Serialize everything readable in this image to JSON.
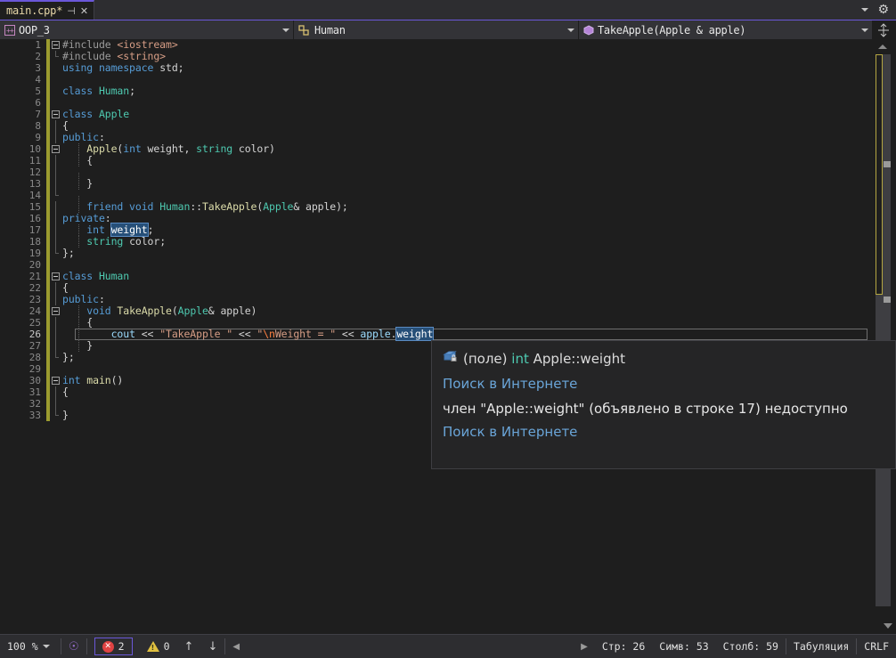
{
  "tab": {
    "title": "main.cpp*",
    "pin_icon": "pin-icon",
    "close_icon": "close-icon",
    "overflow_icon": "chevron-down-icon",
    "settings_icon": "gear-icon"
  },
  "navbar": {
    "project": "OOP_3",
    "project_icon": "cpp-project-icon",
    "class": "Human",
    "class_icon": "class-icon",
    "member": "TakeApple(Apple & apple)",
    "member_icon": "method-icon",
    "split_icon": "split-window-icon"
  },
  "editor": {
    "lines": [
      {
        "n": 1,
        "fold": "minus",
        "indent": 0,
        "mod": true,
        "tokens": [
          {
            "t": "#include ",
            "c": "pp"
          },
          {
            "t": "<iostream>",
            "c": "st"
          }
        ]
      },
      {
        "n": 2,
        "fold": "end",
        "indent": 0,
        "mod": true,
        "tokens": [
          {
            "t": "#include ",
            "c": "pp"
          },
          {
            "t": "<string>",
            "c": "st"
          }
        ]
      },
      {
        "n": 3,
        "fold": "none",
        "indent": 0,
        "mod": true,
        "tokens": [
          {
            "t": "using namespace ",
            "c": "k"
          },
          {
            "t": "std;",
            "c": "pl"
          }
        ]
      },
      {
        "n": 4,
        "fold": "none",
        "indent": 0,
        "mod": true,
        "tokens": []
      },
      {
        "n": 5,
        "fold": "none",
        "indent": 0,
        "mod": true,
        "tokens": [
          {
            "t": "class ",
            "c": "k"
          },
          {
            "t": "Human",
            "c": "ty"
          },
          {
            "t": ";",
            "c": "pl"
          }
        ]
      },
      {
        "n": 6,
        "fold": "none",
        "indent": 0,
        "mod": true,
        "tokens": []
      },
      {
        "n": 7,
        "fold": "minus",
        "indent": 0,
        "mod": true,
        "tokens": [
          {
            "t": "class ",
            "c": "k"
          },
          {
            "t": "Apple",
            "c": "ty"
          }
        ]
      },
      {
        "n": 8,
        "fold": "vline",
        "indent": 0,
        "mod": true,
        "tokens": [
          {
            "t": "{",
            "c": "pl"
          }
        ]
      },
      {
        "n": 9,
        "fold": "vline",
        "indent": 0,
        "mod": true,
        "tokens": [
          {
            "t": "public",
            "c": "k"
          },
          {
            "t": ":",
            "c": "pl"
          }
        ]
      },
      {
        "n": 10,
        "fold": "minus2",
        "indent": 1,
        "mod": true,
        "tokens": [
          {
            "t": "    ",
            "c": "pl"
          },
          {
            "t": "Apple",
            "c": "fn"
          },
          {
            "t": "(",
            "c": "pl"
          },
          {
            "t": "int",
            "c": "k"
          },
          {
            "t": " weight, ",
            "c": "pl"
          },
          {
            "t": "string",
            "c": "ty"
          },
          {
            "t": " color)",
            "c": "pl"
          }
        ]
      },
      {
        "n": 11,
        "fold": "vline",
        "indent": 1,
        "mod": true,
        "tokens": [
          {
            "t": "    {",
            "c": "pl"
          }
        ]
      },
      {
        "n": 12,
        "fold": "vline",
        "indent": 1,
        "mod": true,
        "tokens": []
      },
      {
        "n": 13,
        "fold": "vline",
        "indent": 1,
        "mod": true,
        "tokens": [
          {
            "t": "    }",
            "c": "pl"
          }
        ]
      },
      {
        "n": 14,
        "fold": "vend",
        "indent": 1,
        "mod": true,
        "tokens": []
      },
      {
        "n": 15,
        "fold": "vline",
        "indent": 1,
        "mod": true,
        "tokens": [
          {
            "t": "    ",
            "c": "pl"
          },
          {
            "t": "friend void ",
            "c": "k"
          },
          {
            "t": "Human",
            "c": "ty"
          },
          {
            "t": "::",
            "c": "pl"
          },
          {
            "t": "TakeApple",
            "c": "fn"
          },
          {
            "t": "(",
            "c": "pl"
          },
          {
            "t": "Apple",
            "c": "ty"
          },
          {
            "t": "& apple);",
            "c": "pl"
          }
        ]
      },
      {
        "n": 16,
        "fold": "vline",
        "indent": 0,
        "mod": true,
        "tokens": [
          {
            "t": "private",
            "c": "k"
          },
          {
            "t": ":",
            "c": "pl"
          }
        ]
      },
      {
        "n": 17,
        "fold": "vline",
        "indent": 1,
        "mod": true,
        "tokens": [
          {
            "t": "    ",
            "c": "pl"
          },
          {
            "t": "int",
            "c": "k"
          },
          {
            "t": " ",
            "c": "pl"
          },
          {
            "t": "weight",
            "c": "sel"
          },
          {
            "t": ";",
            "c": "pl"
          }
        ]
      },
      {
        "n": 18,
        "fold": "vline",
        "indent": 1,
        "mod": true,
        "tokens": [
          {
            "t": "    ",
            "c": "pl"
          },
          {
            "t": "string",
            "c": "ty"
          },
          {
            "t": " color;",
            "c": "pl"
          }
        ]
      },
      {
        "n": 19,
        "fold": "end",
        "indent": 0,
        "mod": true,
        "tokens": [
          {
            "t": "};",
            "c": "pl"
          }
        ]
      },
      {
        "n": 20,
        "fold": "none",
        "indent": 0,
        "mod": true,
        "tokens": []
      },
      {
        "n": 21,
        "fold": "minus",
        "indent": 0,
        "mod": true,
        "tokens": [
          {
            "t": "class ",
            "c": "k"
          },
          {
            "t": "Human",
            "c": "ty"
          }
        ]
      },
      {
        "n": 22,
        "fold": "vline",
        "indent": 0,
        "mod": true,
        "tokens": [
          {
            "t": "{",
            "c": "pl"
          }
        ]
      },
      {
        "n": 23,
        "fold": "vline",
        "indent": 0,
        "mod": true,
        "tokens": [
          {
            "t": "public",
            "c": "k"
          },
          {
            "t": ":",
            "c": "pl"
          }
        ]
      },
      {
        "n": 24,
        "fold": "minus2",
        "indent": 1,
        "mod": true,
        "tokens": [
          {
            "t": "    ",
            "c": "pl"
          },
          {
            "t": "void ",
            "c": "k"
          },
          {
            "t": "TakeApple",
            "c": "fn"
          },
          {
            "t": "(",
            "c": "pl"
          },
          {
            "t": "Apple",
            "c": "ty"
          },
          {
            "t": "& apple)",
            "c": "pl"
          }
        ]
      },
      {
        "n": 25,
        "fold": "vline",
        "indent": 1,
        "mod": true,
        "tokens": [
          {
            "t": "    {",
            "c": "pl"
          }
        ]
      },
      {
        "n": 26,
        "fold": "vline",
        "indent": 1,
        "mod": true,
        "current": true,
        "tokens": [
          {
            "t": "        ",
            "c": "pl"
          },
          {
            "t": "cout",
            "c": "vr"
          },
          {
            "t": " << ",
            "c": "pl"
          },
          {
            "t": "\"TakeApple \"",
            "c": "st"
          },
          {
            "t": " << ",
            "c": "pl"
          },
          {
            "t": "\"",
            "c": "st"
          },
          {
            "t": "\\n",
            "c": "es"
          },
          {
            "t": "Weight = \"",
            "c": "st"
          },
          {
            "t": " << ",
            "c": "pl"
          },
          {
            "t": "apple",
            "c": "vr"
          },
          {
            "t": ".",
            "c": "pl"
          },
          {
            "t": "weight",
            "c": "sel"
          }
        ]
      },
      {
        "n": 27,
        "fold": "vline",
        "indent": 1,
        "mod": true,
        "tokens": [
          {
            "t": "    }",
            "c": "pl"
          }
        ]
      },
      {
        "n": 28,
        "fold": "end",
        "indent": 0,
        "mod": true,
        "tokens": [
          {
            "t": "};",
            "c": "pl"
          }
        ]
      },
      {
        "n": 29,
        "fold": "none",
        "indent": 0,
        "mod": true,
        "tokens": []
      },
      {
        "n": 30,
        "fold": "minus",
        "indent": 0,
        "mod": true,
        "tokens": [
          {
            "t": "int ",
            "c": "k"
          },
          {
            "t": "main",
            "c": "fn"
          },
          {
            "t": "()",
            "c": "pl"
          }
        ]
      },
      {
        "n": 31,
        "fold": "vline",
        "indent": 0,
        "mod": true,
        "tokens": [
          {
            "t": "{",
            "c": "pl"
          }
        ]
      },
      {
        "n": 32,
        "fold": "vline",
        "indent": 0,
        "mod": true,
        "tokens": []
      },
      {
        "n": 33,
        "fold": "end",
        "indent": 0,
        "mod": true,
        "tokens": [
          {
            "t": "}",
            "c": "pl"
          }
        ]
      }
    ]
  },
  "tooltip": {
    "icon": "private-field-icon",
    "sig_prefix": "(поле) ",
    "sig_type": "int",
    "sig_name": " Apple::weight",
    "link1": "Поиск в Интернете",
    "message": "член \"Apple::weight\" (объявлено в строке 17) недоступно",
    "link2": "Поиск в Интернете"
  },
  "statusbar": {
    "zoom": "100 %",
    "zoom_caret": "chevron-down-icon",
    "account_icon": "user-head-icon",
    "error_count": "2",
    "error_icon": "error-circle-icon",
    "warning_count": "0",
    "warning_icon": "warning-triangle-icon",
    "prev_icon": "arrow-up-icon",
    "next_icon": "arrow-down-icon",
    "scroll_left_icon": "triangle-left-icon",
    "scroll_right_icon": "triangle-right-icon",
    "line": "Стр: 26",
    "char": "Симв: 53",
    "col": "Столб: 59",
    "indent_mode": "Табуляция",
    "line_ending": "CRLF"
  },
  "colors": {
    "accent": "#6a57d8",
    "editor_bg": "#1e1e1e",
    "chrome_bg": "#2d2d30",
    "error": "#e04343",
    "warning": "#e0c040",
    "selection": "#264f78",
    "change_bar": "#9b9b2f"
  }
}
